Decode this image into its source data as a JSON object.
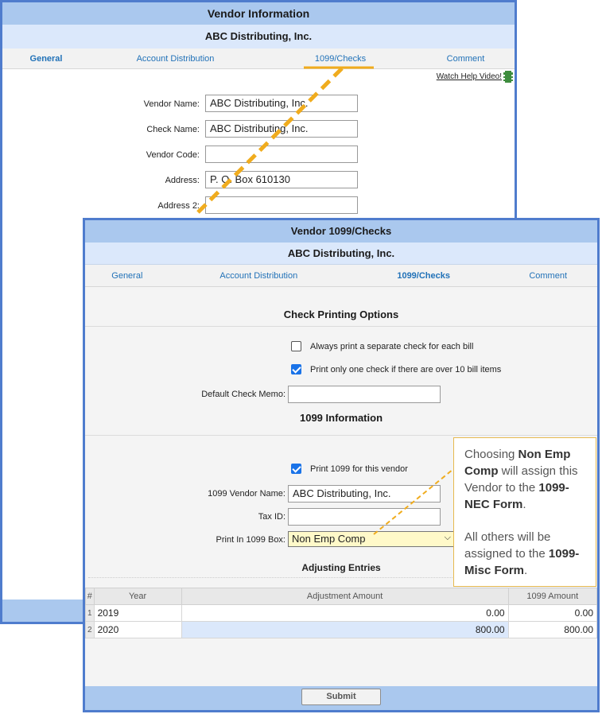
{
  "back_window": {
    "title": "Vendor Information",
    "vendor_name": "ABC Distributing, Inc.",
    "tabs": [
      "General",
      "Account Distribution",
      "1099/Checks",
      "Comment"
    ],
    "help_link": "Watch Help Video!",
    "fields": [
      {
        "label": "Vendor Name:",
        "value": "ABC Distributing, Inc."
      },
      {
        "label": "Check Name:",
        "value": "ABC Distributing, Inc."
      },
      {
        "label": "Vendor Code:",
        "value": ""
      },
      {
        "label": "Address:",
        "value": "P. O. Box 610130"
      },
      {
        "label": "Address 2:",
        "value": ""
      }
    ]
  },
  "front_window": {
    "title": "Vendor 1099/Checks",
    "vendor_name": "ABC Distributing, Inc.",
    "tabs": [
      "General",
      "Account Distribution",
      "1099/Checks",
      "Comment"
    ],
    "active_tab": "1099/Checks",
    "check_section": {
      "title": "Check Printing Options",
      "separate_check_label": "Always print a separate check for each bill",
      "separate_check_checked": false,
      "one_check_label": "Print only one check if there are over 10 bill items",
      "one_check_checked": true,
      "memo_label": "Default Check Memo:",
      "memo_value": ""
    },
    "section_1099": {
      "title": "1099 Information",
      "print_label": "Print 1099 for this vendor",
      "print_checked": true,
      "vendor_name_label": "1099 Vendor Name:",
      "vendor_name_value": "ABC Distributing, Inc.",
      "tax_id_label": "Tax ID:",
      "tax_id_value": "",
      "box_label": "Print In 1099 Box:",
      "box_value": "Non Emp Comp"
    },
    "adjusting": {
      "title": "Adjusting Entries",
      "columns": [
        "#",
        "Year",
        "Adjustment Amount",
        "1099 Amount"
      ],
      "rows": [
        {
          "idx": "1",
          "year": "2019",
          "adjustment": "0.00",
          "amount": "0.00"
        },
        {
          "idx": "2",
          "year": "2020",
          "adjustment": "800.00",
          "amount": "800.00"
        }
      ]
    },
    "submit_label": "Submit"
  },
  "callout": {
    "t1": "Choosing ",
    "b1": "Non Emp Comp",
    "t2": " will assign this Vendor to the ",
    "b2": "1099-NEC Form",
    "t3": ".",
    "t4": "All others will be assigned to the ",
    "b3": "1099-Misc Form",
    "t5": "."
  },
  "colors": {
    "header": "#aac8ee",
    "subheader": "#dbe8fb",
    "window_border": "#4f7ccd",
    "tab_link": "#2272b8",
    "highlight": "#fff9c9",
    "callout_border": "#e6b94f",
    "dash": "#f0ac1e"
  }
}
